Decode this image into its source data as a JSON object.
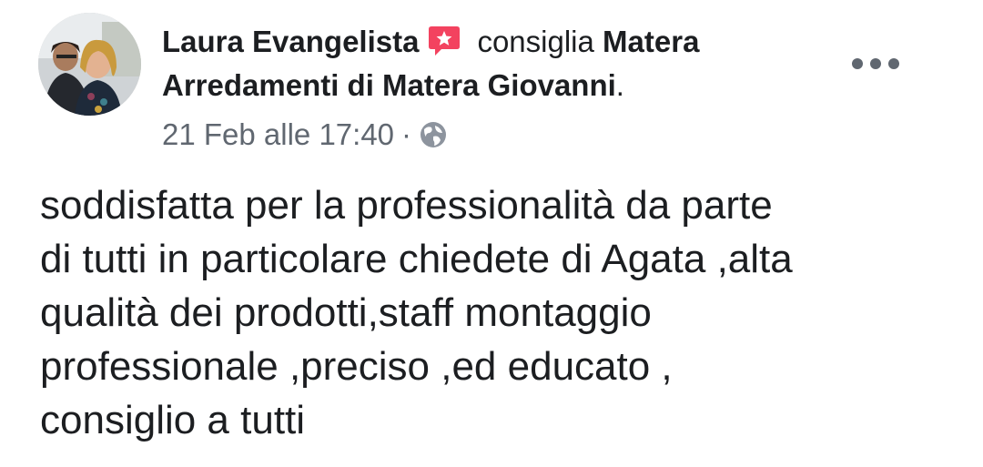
{
  "post": {
    "author": "Laura Evangelista",
    "action": "consiglia",
    "page_name": "Matera Arredamenti di Matera Giovanni",
    "page_suffix": ".",
    "timestamp": "21 Feb alle 17:40",
    "separator": "·",
    "privacy_icon": "globe-icon",
    "recommend_icon": "recommendation-star-icon",
    "more_icon": "more-options-icon",
    "recommend_color": "#f3425f",
    "body_lines": [
      "soddisfatta per la professionalità da parte",
      "di tutti in particolare chiedete di Agata ,alta",
      "qualità dei prodotti,staff montaggio",
      "professionale ,preciso ,ed educato ,",
      "consiglio a tutti"
    ]
  }
}
